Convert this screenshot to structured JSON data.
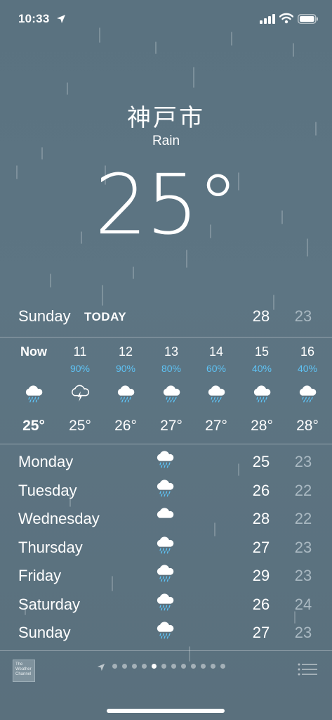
{
  "status_bar": {
    "time": "10:33"
  },
  "header": {
    "city": "神戸市",
    "condition": "Rain",
    "temperature": "25°"
  },
  "today": {
    "day": "Sunday",
    "tag": "TODAY",
    "high": "28",
    "low": "23"
  },
  "hourly": [
    {
      "time": "Now",
      "pop": "",
      "icon": "rain-cloud-icon",
      "temp": "25°"
    },
    {
      "time": "11",
      "pop": "90%",
      "icon": "thunderstorm-icon",
      "temp": "25°"
    },
    {
      "time": "12",
      "pop": "90%",
      "icon": "rain-cloud-icon",
      "temp": "26°"
    },
    {
      "time": "13",
      "pop": "80%",
      "icon": "rain-cloud-icon",
      "temp": "27°"
    },
    {
      "time": "14",
      "pop": "60%",
      "icon": "rain-cloud-icon",
      "temp": "27°"
    },
    {
      "time": "15",
      "pop": "40%",
      "icon": "rain-cloud-icon",
      "temp": "28°"
    },
    {
      "time": "16",
      "pop": "40%",
      "icon": "rain-cloud-icon",
      "temp": "28°"
    }
  ],
  "daily": [
    {
      "day": "Monday",
      "icon": "rain-cloud-icon",
      "high": "25",
      "low": "23"
    },
    {
      "day": "Tuesday",
      "icon": "rain-cloud-icon",
      "high": "26",
      "low": "22"
    },
    {
      "day": "Wednesday",
      "icon": "cloud-icon",
      "high": "28",
      "low": "22"
    },
    {
      "day": "Thursday",
      "icon": "rain-cloud-icon",
      "high": "27",
      "low": "23"
    },
    {
      "day": "Friday",
      "icon": "rain-cloud-icon",
      "high": "29",
      "low": "23"
    },
    {
      "day": "Saturday",
      "icon": "rain-cloud-icon",
      "high": "26",
      "low": "24"
    },
    {
      "day": "Sunday",
      "icon": "rain-cloud-icon",
      "high": "27",
      "low": "23"
    }
  ],
  "footer": {
    "logo_lines": [
      "The",
      "Weather",
      "Channel"
    ],
    "page_count": 12,
    "active_page": 4
  },
  "colors": {
    "precip": "#5ec3f5",
    "low_temp": "#aab9c2",
    "background": "#5a7280"
  }
}
